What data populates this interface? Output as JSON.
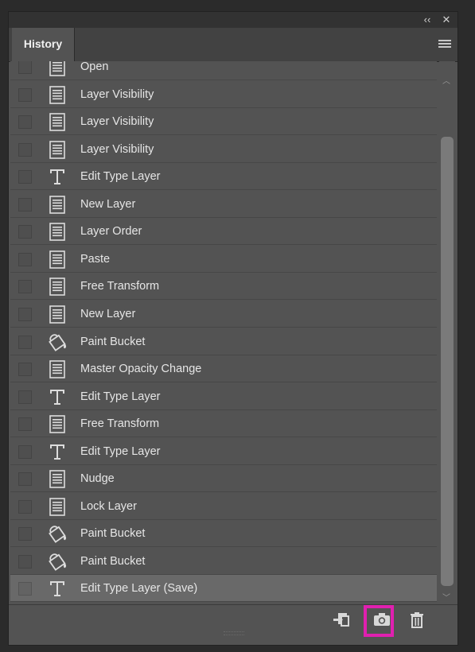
{
  "panel": {
    "tab_label": "History",
    "collapse_glyph": "‹‹",
    "close_glyph": "✕",
    "highlight_color": "#e020b0"
  },
  "history_items": [
    {
      "label": "Open",
      "icon": "document-icon"
    },
    {
      "label": "Layer Visibility",
      "icon": "document-icon"
    },
    {
      "label": "Layer Visibility",
      "icon": "document-icon"
    },
    {
      "label": "Layer Visibility",
      "icon": "document-icon"
    },
    {
      "label": "Edit Type Layer",
      "icon": "type-icon"
    },
    {
      "label": "New Layer",
      "icon": "document-icon"
    },
    {
      "label": "Layer Order",
      "icon": "document-icon"
    },
    {
      "label": "Paste",
      "icon": "document-icon"
    },
    {
      "label": "Free Transform",
      "icon": "document-icon"
    },
    {
      "label": "New Layer",
      "icon": "document-icon"
    },
    {
      "label": "Paint Bucket",
      "icon": "paint-bucket-icon"
    },
    {
      "label": "Master Opacity Change",
      "icon": "document-icon"
    },
    {
      "label": "Edit Type Layer",
      "icon": "type-icon"
    },
    {
      "label": "Free Transform",
      "icon": "document-icon"
    },
    {
      "label": "Edit Type Layer",
      "icon": "type-icon"
    },
    {
      "label": "Nudge",
      "icon": "document-icon"
    },
    {
      "label": "Lock Layer",
      "icon": "document-icon"
    },
    {
      "label": "Paint Bucket",
      "icon": "paint-bucket-icon"
    },
    {
      "label": "Paint Bucket",
      "icon": "paint-bucket-icon"
    },
    {
      "label": "Edit Type Layer (Save)",
      "icon": "type-icon",
      "selected": true
    }
  ],
  "bottom_bar": {
    "buttons": [
      "new-document-from-state-icon",
      "camera-icon",
      "trash-icon"
    ],
    "highlighted": "camera-icon"
  }
}
